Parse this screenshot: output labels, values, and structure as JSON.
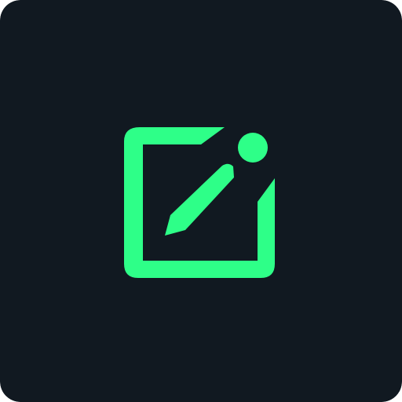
{
  "icon": {
    "name": "edit-note-icon",
    "background_color": "#111921",
    "accent_color": "#2EFF88"
  }
}
